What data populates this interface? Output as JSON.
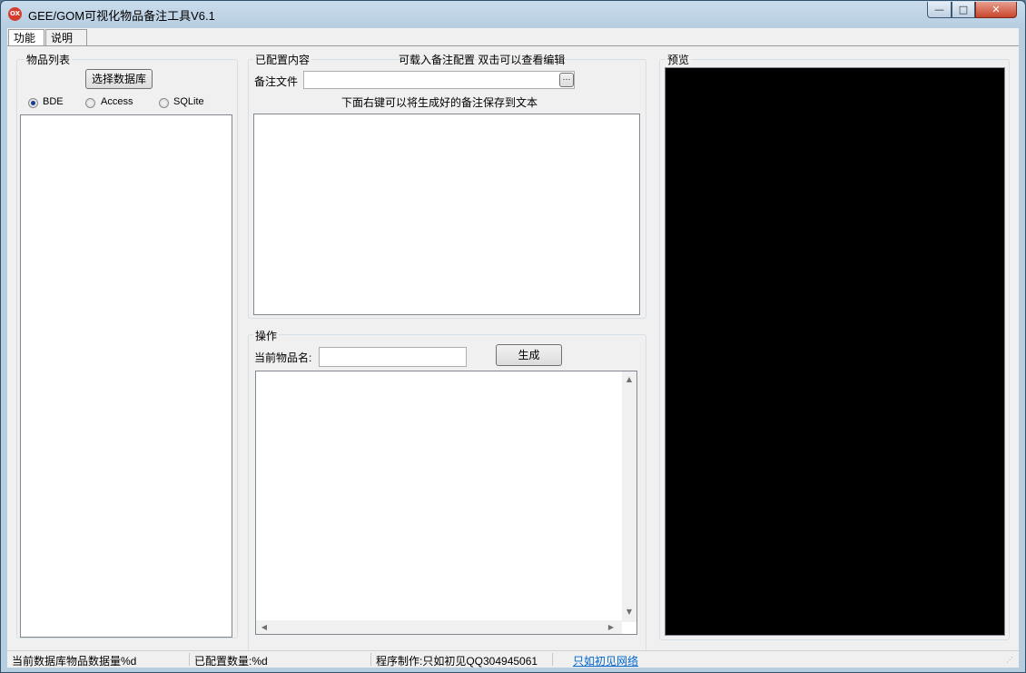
{
  "window": {
    "title": "GEE/GOM可视化物品备注工具V6.1",
    "icon_text": "OX",
    "controls": {
      "minimize": "—",
      "maximize": "□",
      "close": "✕"
    }
  },
  "tabs": [
    {
      "label": "功能",
      "active": true
    },
    {
      "label": "说明",
      "active": false
    }
  ],
  "item_list": {
    "group_label": "物品列表",
    "select_db_button": "选择数据库",
    "radios": [
      {
        "label": "BDE",
        "checked": true
      },
      {
        "label": "Access",
        "checked": false
      },
      {
        "label": "SQLite",
        "checked": false
      }
    ]
  },
  "config": {
    "group_label": "已配置内容",
    "hint_top": "可载入备注配置 双击可以查看编辑",
    "file_label": "备注文件",
    "file_value": "",
    "browse_button": "···",
    "hint_save": "下面右键可以将生成好的备注保存到文本"
  },
  "operation": {
    "group_label": "操作",
    "name_label": "当前物品名:",
    "name_value": "",
    "generate_button": "生成"
  },
  "preview": {
    "group_label": "预览"
  },
  "status": {
    "db_count": "当前数据库物品数据量%d",
    "config_count": "已配置数量:%d",
    "author": "程序制作:只如初见QQ304945061",
    "link": "只如初见网络"
  },
  "colors": {
    "title_gradient_top": "#c9dcec",
    "close_button": "#c7452c",
    "preview_bg": "#000000",
    "link": "#0066cc"
  }
}
